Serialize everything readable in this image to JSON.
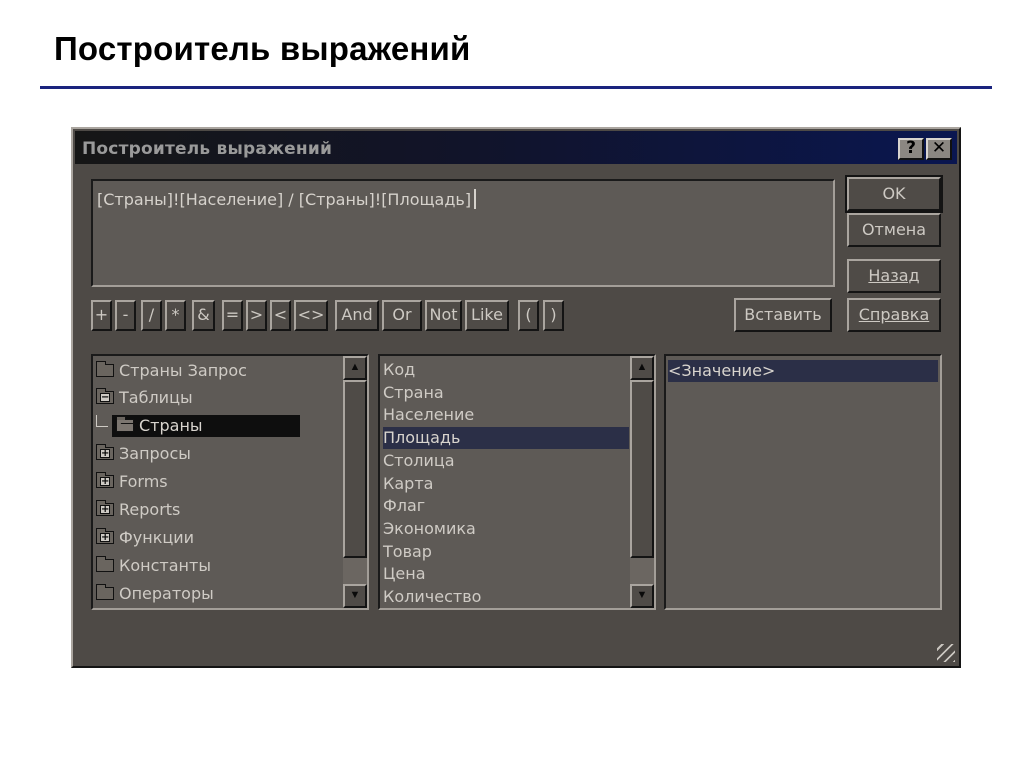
{
  "slide": {
    "title": "Построитель выражений"
  },
  "dialog": {
    "title": "Построитель выражений",
    "help_icon": "?",
    "close_icon": "✕",
    "expression": "[Страны]![Население] / [Страны]![Площадь]",
    "buttons": {
      "ok": "OK",
      "cancel": "Отмена",
      "back": "Назад",
      "insert": "Вставить",
      "help": "Справка"
    },
    "operators": [
      "+",
      "-",
      "/",
      "*",
      "&",
      "=",
      ">",
      "<",
      "<>",
      "And",
      "Or",
      "Not",
      "Like",
      "(",
      ")"
    ],
    "tree": [
      {
        "label": "Страны Запрос",
        "icon": "folder-icon"
      },
      {
        "label": "Таблицы",
        "icon": "folder-icon",
        "expander": "−"
      },
      {
        "label": "Страны",
        "icon": "open-folder-icon",
        "selected": true
      },
      {
        "label": "Запросы",
        "icon": "folder-icon",
        "expander": "+"
      },
      {
        "label": "Forms",
        "icon": "folder-icon",
        "expander": "+"
      },
      {
        "label": "Reports",
        "icon": "folder-icon",
        "expander": "+"
      },
      {
        "label": "Функции",
        "icon": "folder-icon",
        "expander": "+"
      },
      {
        "label": "Константы",
        "icon": "folder-icon"
      },
      {
        "label": "Операторы",
        "icon": "folder-icon"
      }
    ],
    "fields": [
      "Код",
      "Страна",
      "Население",
      "Площадь",
      "Столица",
      "Карта",
      "Флаг",
      "Экономика",
      "Товар",
      "Цена",
      "Количество"
    ],
    "selected_field": "Площадь",
    "values": [
      "<Значение>"
    ],
    "colors": {
      "titlebar_end": "#0a1650",
      "selection": "#2b2f47",
      "rule": "#1a237e"
    }
  }
}
